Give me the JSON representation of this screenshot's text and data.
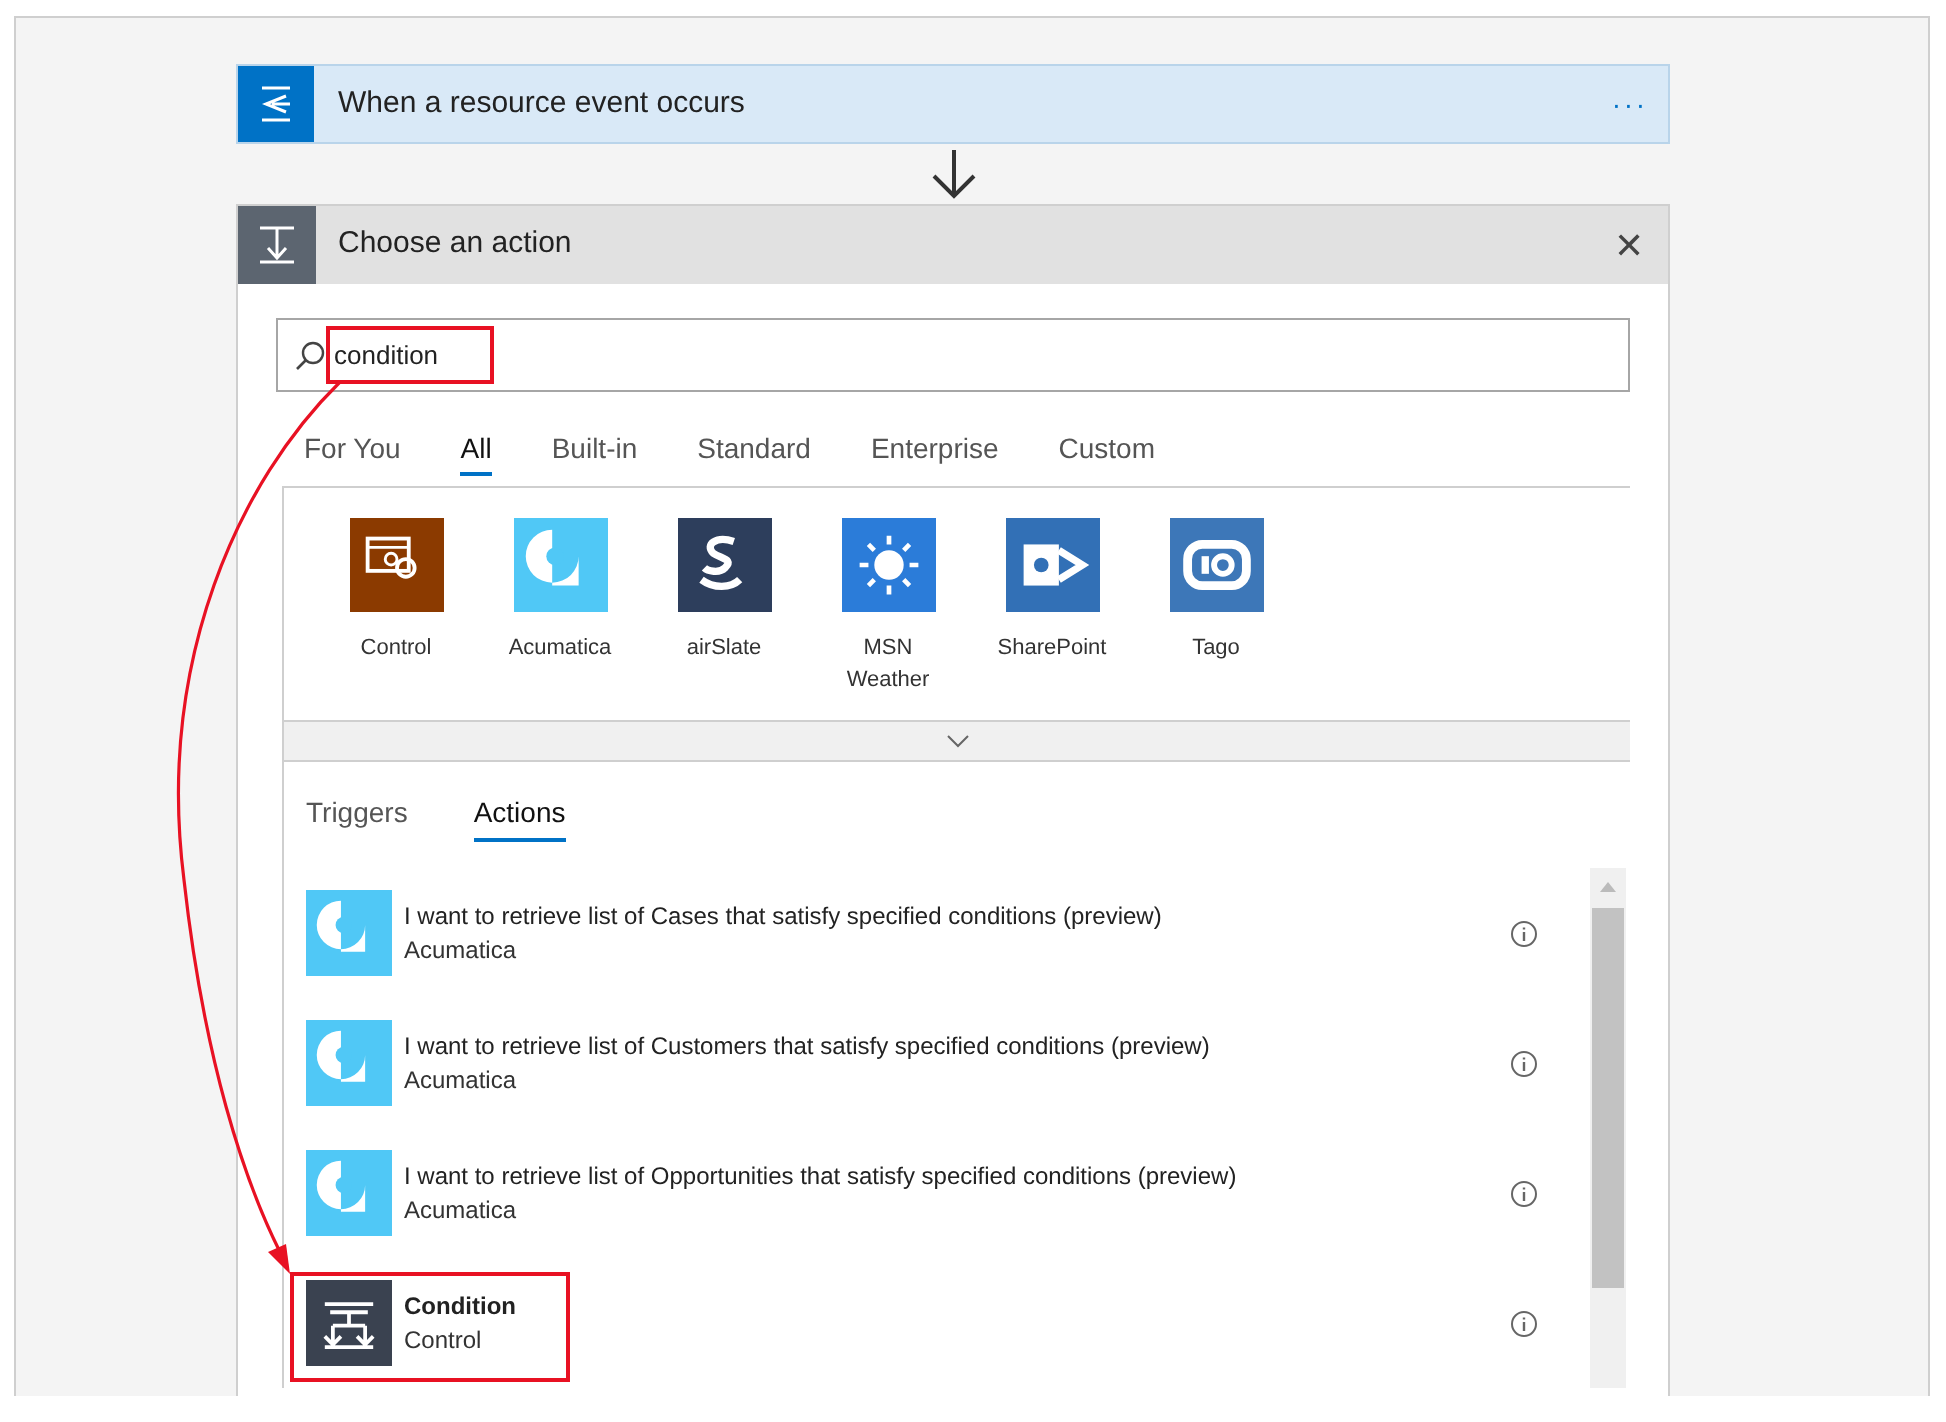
{
  "trigger": {
    "title": "When a resource event occurs",
    "menu": "···"
  },
  "action_picker": {
    "title": "Choose an action",
    "close": "✕",
    "search": {
      "value": "condition"
    },
    "category_tabs": [
      {
        "label": "For You",
        "selected": false
      },
      {
        "label": "All",
        "selected": true
      },
      {
        "label": "Built-in",
        "selected": false
      },
      {
        "label": "Standard",
        "selected": false
      },
      {
        "label": "Enterprise",
        "selected": false
      },
      {
        "label": "Custom",
        "selected": false
      }
    ],
    "connectors": [
      {
        "name": "Control",
        "kind": "control",
        "color": "#8b3a00"
      },
      {
        "name": "Acumatica",
        "kind": "acumatica",
        "color": "#50c8f6"
      },
      {
        "name": "airSlate",
        "kind": "airslate",
        "color": "#2d3e5c"
      },
      {
        "name": "MSN Weather",
        "kind": "weather",
        "color": "#2b7cd9"
      },
      {
        "name": "SharePoint",
        "kind": "sharepoint",
        "color": "#3270b6"
      },
      {
        "name": "Tago",
        "kind": "tago",
        "color": "#3d77b8"
      }
    ],
    "result_tabs": [
      {
        "label": "Triggers",
        "selected": false
      },
      {
        "label": "Actions",
        "selected": true
      }
    ],
    "actions": [
      {
        "title": "I want to retrieve list of Cases that satisfy specified conditions (preview)",
        "connector": "Acumatica",
        "kind": "acumatica",
        "color": "#50c8f6"
      },
      {
        "title": "I want to retrieve list of Customers that satisfy specified conditions (preview)",
        "connector": "Acumatica",
        "kind": "acumatica",
        "color": "#50c8f6"
      },
      {
        "title": "I want to retrieve list of Opportunities that satisfy specified conditions (preview)",
        "connector": "Acumatica",
        "kind": "acumatica",
        "color": "#50c8f6"
      },
      {
        "title": "Condition",
        "connector": "Control",
        "kind": "condition",
        "color": "#3a4250"
      }
    ]
  }
}
